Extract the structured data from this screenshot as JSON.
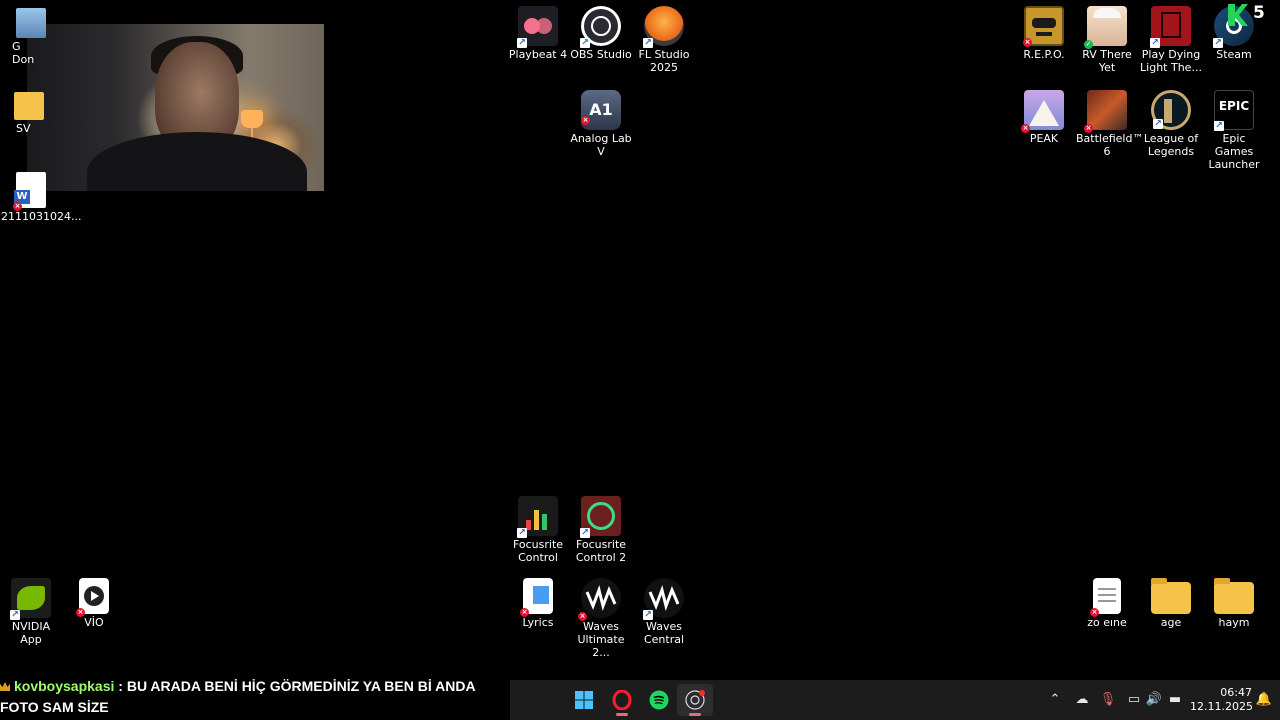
{
  "desktop": {
    "icons": {
      "playbeat": "Playbeat 4",
      "obs": "OBS Studio",
      "fl_line1": "FL Studio",
      "fl_line2": "2025",
      "analog": "Analog Lab V",
      "repo": "R.E.P.O.",
      "rv": "RV There Yet",
      "dying_line1": "Play Dying",
      "dying_line2": "Light The...",
      "steam": "Steam",
      "peak": "PEAK",
      "bf_line1": "Battlefield™",
      "bf_line2": "6",
      "lol_line1": "League of",
      "lol_line2": "Legends",
      "epic_line1": "Epic Games",
      "epic_line2": "Launcher",
      "left1": "G\nDon",
      "left2": "SV",
      "doc": "2111031024...",
      "focus1_line1": "Focusrite",
      "focus1_line2": "Control",
      "focus2_line1": "Focusrite",
      "focus2_line2": "Control 2",
      "nvidia": "NVIDIA App",
      "vio": "VİO",
      "lyrics": "Lyrics",
      "waves1_line1": "Waves",
      "waves1_line2": "Ultimate 2...",
      "waves2_line1": "Waves",
      "waves2_line2": "Central",
      "zo": "zo eıne",
      "age": "age",
      "haym": "haym"
    },
    "steam_badge": "5",
    "epic_logo_text": "EPIC",
    "analog_logo_text": "A1"
  },
  "chat": {
    "username": "kovboysapkasi",
    "separator": " : ",
    "message": "BU ARADA BENİ HİÇ GÖRMEDİNİZ YA BEN Bİ ANDA FOTO SAM SİZE"
  },
  "taskbar": {
    "apps": [
      "start-menu",
      "opera",
      "spotify",
      "obs"
    ],
    "clock": {
      "time": "06:47",
      "date": "12.11.2025"
    }
  },
  "colors": {
    "taskbar_bg": "#1c1c1c",
    "chat_username": "#9dff6b",
    "accent_pink": "#e06a8a"
  }
}
